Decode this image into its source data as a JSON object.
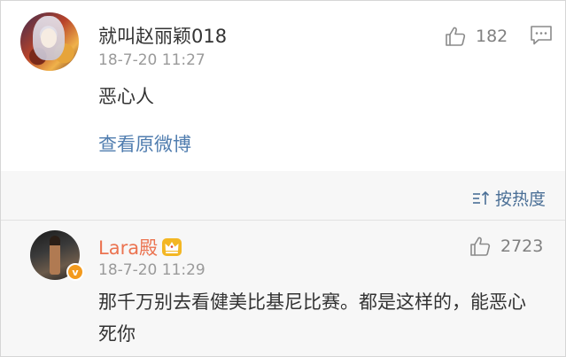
{
  "top_comment": {
    "user_name": "就叫赵丽颖018",
    "timestamp": "18-7-20 11:27",
    "text": "恶心人",
    "view_original_link": "查看原微博",
    "like_count": "182",
    "icons": {
      "like": "thumbs-up-icon",
      "reply": "comment-icon"
    }
  },
  "replies_section": {
    "sort_label": "按热度",
    "sort_icon": "sort-icon"
  },
  "reply": {
    "user_name": "Lara殿",
    "timestamp": "18-7-20 11:29",
    "text": "那千万别去看健美比基尼比赛。都是这样的，能恶心死你",
    "like_count": "2723",
    "verified_badge": "v",
    "icons": {
      "like": "thumbs-up-icon",
      "crown": "crown-icon"
    }
  },
  "colors": {
    "link": "#507daf",
    "username_vip": "#eb7350",
    "timestamp": "#9a9a9a",
    "section_bg": "#f7f7f7"
  }
}
